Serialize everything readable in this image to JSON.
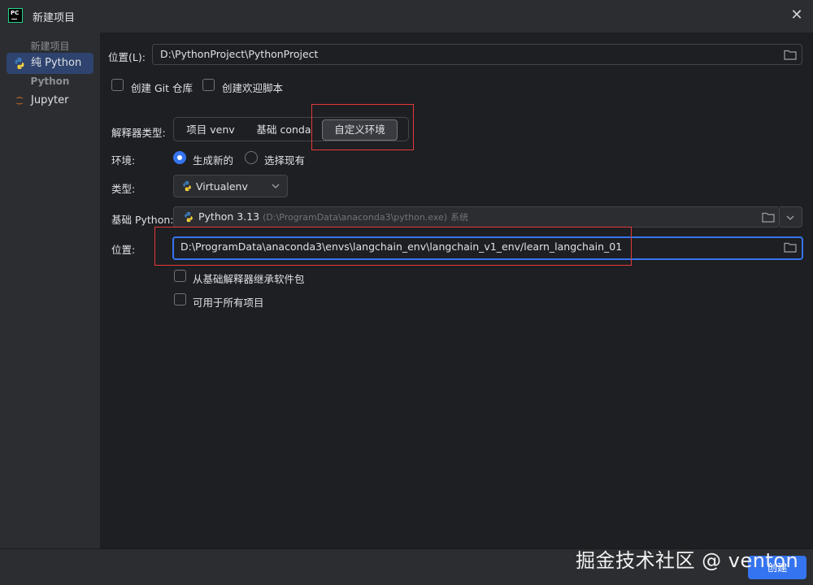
{
  "window": {
    "title": "新建项目"
  },
  "sidebar": {
    "group1": "新建项目",
    "item_pure_python": "纯 Python",
    "group2": "Python",
    "item_jupyter": "Jupyter"
  },
  "location": {
    "label": "位置(L):",
    "value": "D:\\PythonProject\\PythonProject"
  },
  "options": {
    "git_label": "创建 Git 仓库",
    "welcome_label": "创建欢迎脚本"
  },
  "interpreter": {
    "type_label": "解释器类型:",
    "tabs": [
      "项目 venv",
      "基础 conda",
      "自定义环境"
    ],
    "selected_tab": "自定义环境"
  },
  "env": {
    "label": "环境:",
    "new_label": "生成新的",
    "existing_label": "选择现有",
    "selected": "生成新的"
  },
  "kind": {
    "label": "类型:",
    "value": "Virtualenv"
  },
  "base_python": {
    "label": "基础 Python:",
    "name": "Python 3.13",
    "path": "(D:\\ProgramData\\anaconda3\\python.exe)",
    "tag": "系统"
  },
  "env_location": {
    "label": "位置:",
    "value": "D:\\ProgramData\\anaconda3\\envs\\langchain_env\\langchain_v1_env/learn_langchain_01"
  },
  "env_options": {
    "inherit_label": "从基础解释器继承软件包",
    "all_projects_label": "可用于所有项目"
  },
  "footer": {
    "create_label": "创建"
  },
  "watermark": "掘金技术社区 @ venton",
  "colors": {
    "accent": "#3574f0",
    "highlight_box": "#e5393b",
    "selected_sidebar": "#2e436e"
  }
}
